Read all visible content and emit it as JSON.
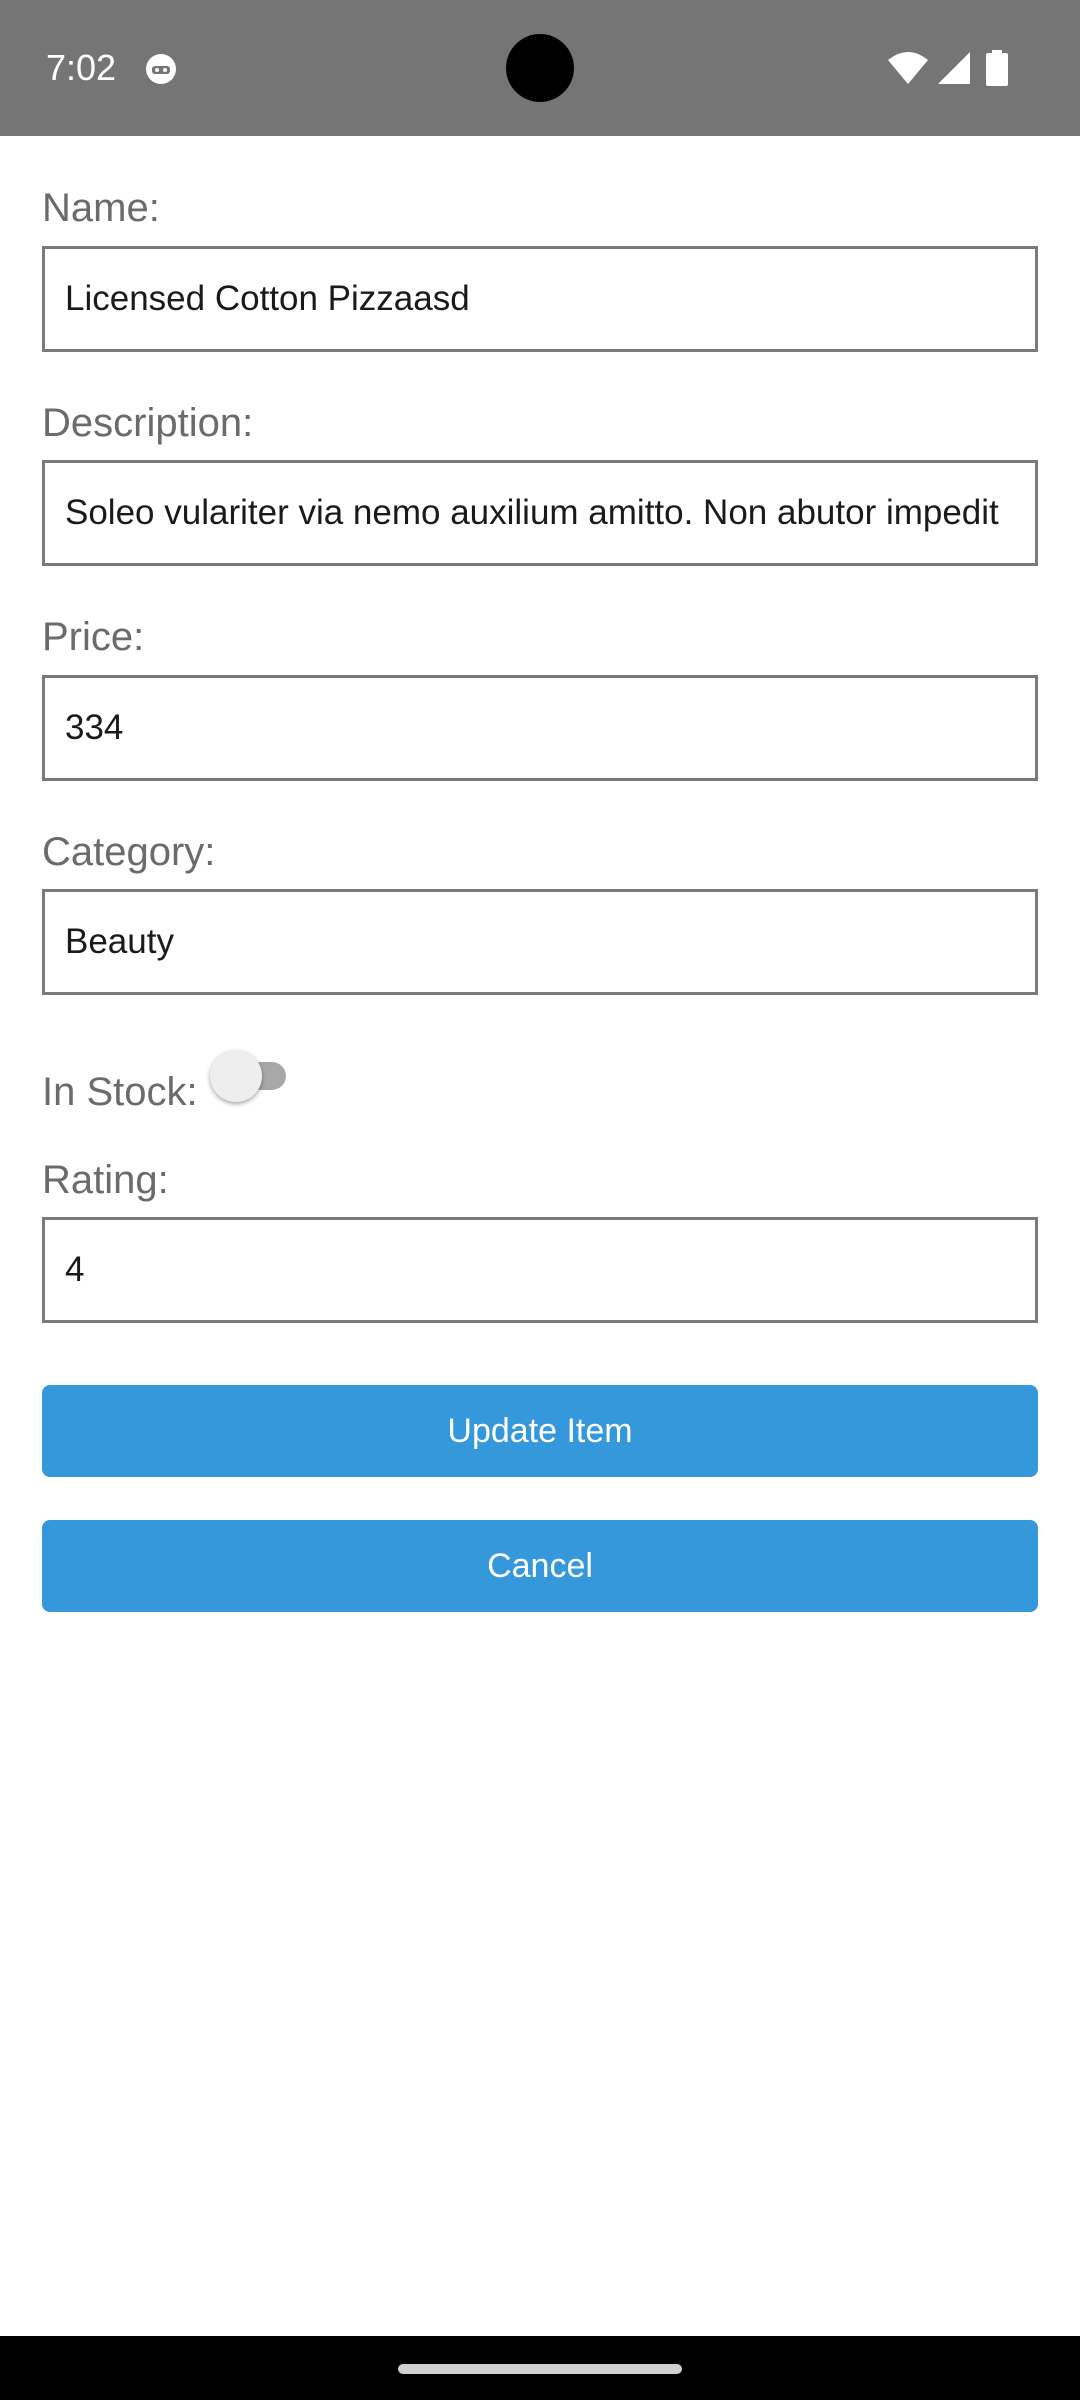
{
  "status_bar": {
    "time": "7:02",
    "icons": [
      "app-notification-icon",
      "wifi-icon",
      "signal-icon",
      "battery-icon"
    ]
  },
  "form": {
    "name": {
      "label": "Name:",
      "value": "Licensed Cotton Pizzaasd"
    },
    "description": {
      "label": "Description:",
      "value": "Soleo vulariter via nemo auxilium amitto. Non abutor impedit"
    },
    "price": {
      "label": "Price:",
      "value": "334"
    },
    "category": {
      "label": "Category:",
      "value": "Beauty"
    },
    "in_stock": {
      "label": "In Stock:",
      "checked": false
    },
    "rating": {
      "label": "Rating:",
      "value": "4"
    }
  },
  "actions": {
    "update_label": "Update Item",
    "cancel_label": "Cancel"
  },
  "colors": {
    "status_bar": "#757575",
    "button": "#3498db",
    "label": "#6b6b6b",
    "input_border": "#7a7a7a"
  }
}
